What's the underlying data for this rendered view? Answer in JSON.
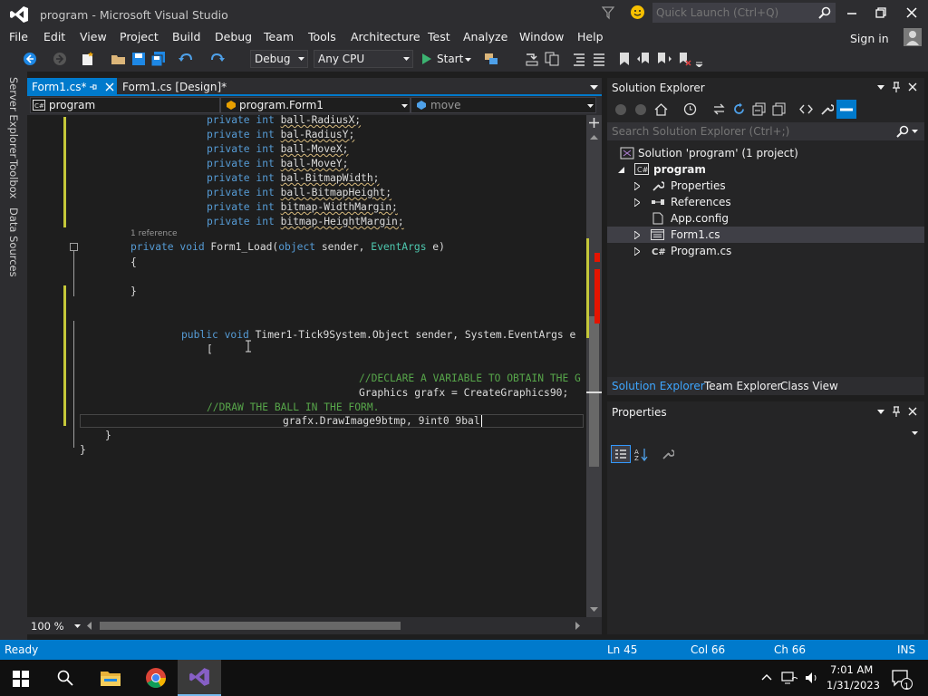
{
  "window": {
    "title": "program - Microsoft Visual Studio",
    "quick_launch_placeholder": "Quick Launch (Ctrl+Q)",
    "sign_in": "Sign in"
  },
  "menu": [
    "File",
    "Edit",
    "View",
    "Project",
    "Build",
    "Debug",
    "Team",
    "Tools",
    "Architecture",
    "Test",
    "Analyze",
    "Window",
    "Help"
  ],
  "toolbar": {
    "config": "Debug",
    "platform": "Any CPU",
    "start": "Start"
  },
  "left_tabs": [
    "Server Explorer",
    "Toolbox",
    "Data Sources"
  ],
  "doc_tabs": [
    {
      "label": "Form1.cs*",
      "active": true
    },
    {
      "label": "Form1.cs [Design]*",
      "active": false
    }
  ],
  "nav": {
    "project": "program",
    "class": "program.Form1",
    "member": "move"
  },
  "code": {
    "lines": [
      {
        "kw": "private int ",
        "id": "ball-RadiusX;"
      },
      {
        "kw": "private int ",
        "id": "bal-RadiusY;"
      },
      {
        "kw": "private int ",
        "id": "ball-MoveX;"
      },
      {
        "kw": "private int ",
        "id": "ball-MoveY;"
      },
      {
        "kw": "private int ",
        "id": "bal-BitmapWidth;"
      },
      {
        "kw": "private int ",
        "id": "ball-BitmapHeight;"
      },
      {
        "kw": "private int ",
        "id": "bitmap-WidthMargin;"
      },
      {
        "kw": "private int ",
        "id": "bitmap-HeightMargin;"
      }
    ],
    "reference": "1 reference",
    "load_kw": "private void ",
    "load_name": "Form1_Load(",
    "load_obj": "object",
    "load_rest": " sender, ",
    "load_args": "EventArgs",
    "load_end": " e)",
    "brace_open": "{",
    "brace_close": "}",
    "timer_kw": "public void ",
    "timer_rest": "Timer1-Tick9System.Object sender, System.EventArgs e",
    "bracket": "[",
    "comment1": "//DECLARE A VARIABLE TO OBTAIN THE G",
    "graphics_line": "Graphics grafx = CreateGraphics90;",
    "comment2": "//DRAW THE BALL IN THE FORM.",
    "draw_line": "grafx.DrawImage9btmp, 9int0 9bal",
    "close1": "}",
    "close2": "}"
  },
  "zoom": "100 %",
  "solution_explorer": {
    "title": "Solution Explorer",
    "search_placeholder": "Search Solution Explorer (Ctrl+;)",
    "solution": "Solution 'program' (1 project)",
    "project": "program",
    "items": [
      "Properties",
      "References",
      "App.config",
      "Form1.cs",
      "Program.cs"
    ],
    "bottom_tabs": [
      "Solution Explorer",
      "Team Explorer",
      "Class View"
    ]
  },
  "properties": {
    "title": "Properties"
  },
  "status": {
    "ready": "Ready",
    "ln": "Ln 45",
    "col": "Col 66",
    "ch": "Ch 66",
    "ins": "INS"
  },
  "taskbar": {
    "time": "7:01 AM",
    "date": "1/31/2023",
    "notif_count": "1"
  },
  "colors": {
    "accent": "#007acc",
    "vs_purple": "#865fc5",
    "keyword": "#569cd6",
    "type": "#4ec9b0",
    "comment": "#57a64a"
  }
}
